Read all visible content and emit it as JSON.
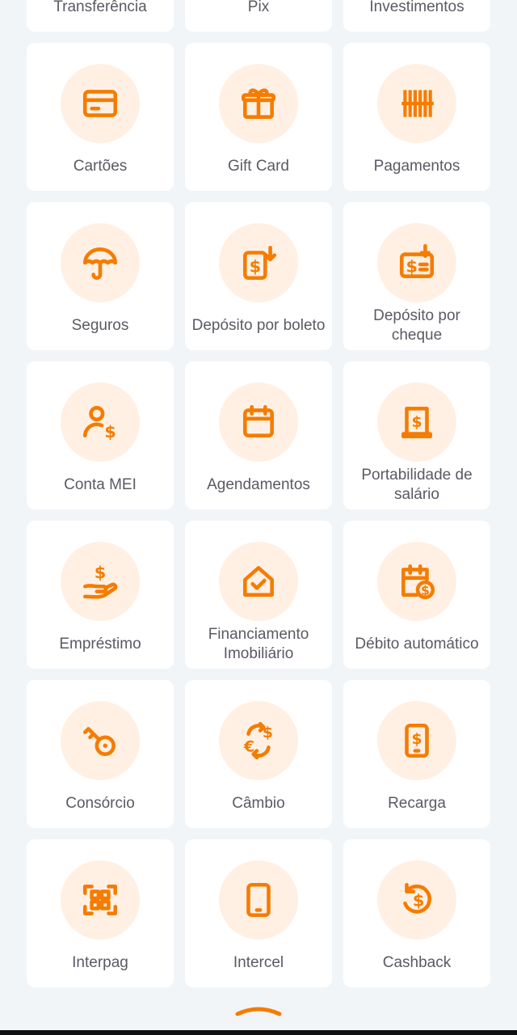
{
  "colors": {
    "accent": "#f57c00",
    "icon_bg": "#fff0e3",
    "tile_bg": "#ffffff",
    "page_bg": "#f2f5f8",
    "label": "#5a5a63"
  },
  "services": [
    {
      "label": "Transferência",
      "icon": "transfer-icon"
    },
    {
      "label": "Pix",
      "icon": "pix-icon"
    },
    {
      "label": "Investimentos",
      "icon": "investments-icon"
    },
    {
      "label": "Cartões",
      "icon": "card-icon"
    },
    {
      "label": "Gift Card",
      "icon": "gift-icon"
    },
    {
      "label": "Pagamentos",
      "icon": "barcode-icon"
    },
    {
      "label": "Seguros",
      "icon": "umbrella-icon"
    },
    {
      "label": "Depósito por boleto",
      "icon": "boleto-deposit-icon"
    },
    {
      "label": "Depósito por cheque",
      "icon": "cheque-deposit-icon"
    },
    {
      "label": "Conta MEI",
      "icon": "user-money-icon"
    },
    {
      "label": "Agendamentos",
      "icon": "calendar-icon"
    },
    {
      "label": "Portabilidade de salário",
      "icon": "salary-document-icon"
    },
    {
      "label": "Empréstimo",
      "icon": "hand-money-icon"
    },
    {
      "label": "Financiamento Imobiliário",
      "icon": "house-check-icon"
    },
    {
      "label": "Débito automático",
      "icon": "calendar-money-icon"
    },
    {
      "label": "Consórcio",
      "icon": "key-icon"
    },
    {
      "label": "Câmbio",
      "icon": "exchange-icon"
    },
    {
      "label": "Recarga",
      "icon": "phone-money-icon"
    },
    {
      "label": "Interpag",
      "icon": "qr-code-icon"
    },
    {
      "label": "Intercel",
      "icon": "phone-icon"
    },
    {
      "label": "Cashback",
      "icon": "cashback-icon"
    }
  ],
  "collapse": {
    "icon": "chevron-up-icon"
  }
}
